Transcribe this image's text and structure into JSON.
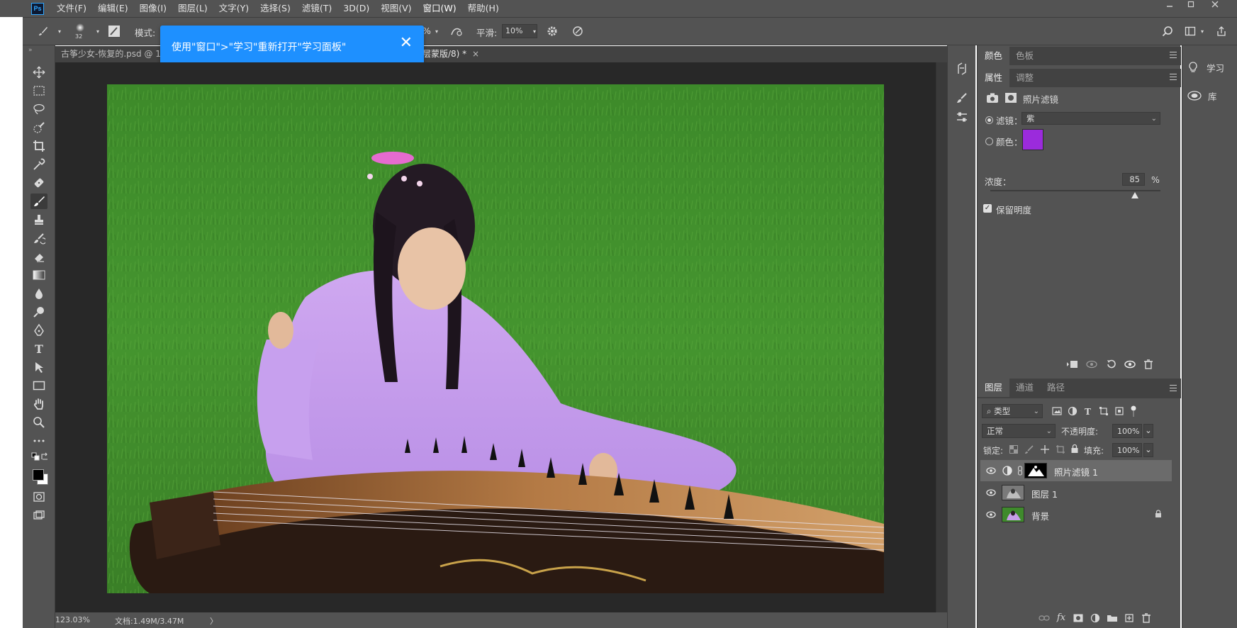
{
  "app": {
    "logo": "Ps",
    "menu": [
      "文件(F)",
      "编辑(E)",
      "图像(I)",
      "图层(L)",
      "文字(Y)",
      "选择(S)",
      "滤镜(T)",
      "3D(D)",
      "视图(V)",
      "窗口(W)",
      "帮助(H)"
    ],
    "window_controls": [
      "minimize-icon",
      "restore-icon",
      "close-icon"
    ]
  },
  "options_bar": {
    "brush_size": "32",
    "mode_label": "模式:",
    "opacity_partial": "%",
    "smoothing_label": "平滑:",
    "smoothing_value": "10%"
  },
  "tooltip": {
    "text": "使用\"窗口\">\"学习\"重新打开\"学习面板\"",
    "close_glyph": "✕"
  },
  "tabs": {
    "doc1": "古筝少女-恢复的.psd @ 1",
    "doc2": "层蒙版/8) *",
    "close_glyph": "×"
  },
  "statusbar": {
    "zoom": "123.03%",
    "doc_info": "文档:1.49M/3.47M",
    "arrow": "〉"
  },
  "properties_panel": {
    "top_tabs": [
      "颜色",
      "色板"
    ],
    "tabs": [
      "属性",
      "调整"
    ],
    "adjustment_title": "照片滤镜",
    "filter_label": "滤镜：",
    "filter_value": "紫",
    "color_label": "颜色：",
    "color_swatch": "#9b2bdc",
    "density_label": "浓度：",
    "density_value": "85",
    "density_unit": "%",
    "density_level": 0.85,
    "preserve_luminosity_label": "保留明度",
    "preserve_luminosity_checked": true
  },
  "layers_panel": {
    "tabs": [
      "图层",
      "通道",
      "路径"
    ],
    "filter_kind": "类型",
    "blend_mode": "正常",
    "opacity_label": "不透明度:",
    "opacity_value": "100%",
    "lock_label": "锁定:",
    "fill_label": "填充:",
    "fill_value": "100%",
    "layers": [
      {
        "name": "照片滤镜 1",
        "selected": true,
        "locked": false
      },
      {
        "name": "图层 1",
        "selected": false,
        "locked": false
      },
      {
        "name": "背景",
        "selected": false,
        "locked": true
      }
    ]
  },
  "right_dock": {
    "learn_label": "学习",
    "library_label": "库"
  },
  "colors": {
    "panel_bg": "#535353",
    "tooltip_bg": "#1e90ff",
    "swatch_purple": "#9b2bdc"
  }
}
